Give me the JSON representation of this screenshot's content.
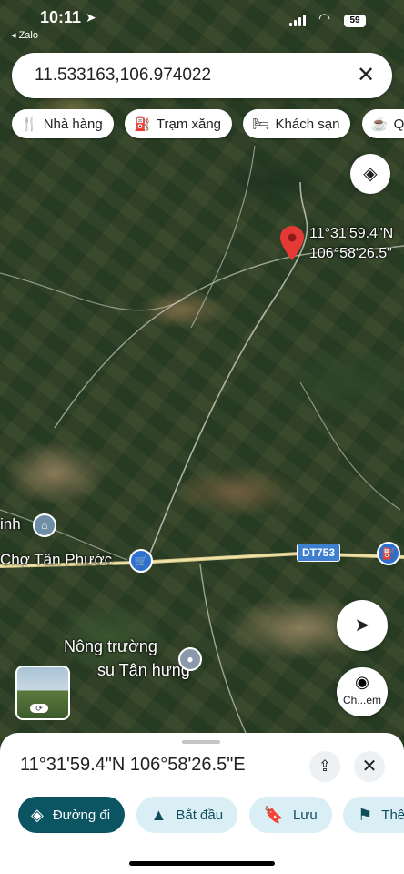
{
  "status_bar": {
    "time": "10:11",
    "back_app": "◂ Zalo",
    "battery": "59"
  },
  "search": {
    "query": "11.533163,106.974022"
  },
  "chips": [
    {
      "icon": "🍴",
      "icon_name": "restaurant-icon",
      "label": "Nhà hàng"
    },
    {
      "icon": "⛽",
      "icon_name": "gas-station-icon",
      "label": "Trạm xăng"
    },
    {
      "icon": "🛏",
      "icon_name": "hotel-icon",
      "label": "Khách sạn"
    },
    {
      "icon": "☕",
      "icon_name": "cafe-icon",
      "label": "Quá"
    }
  ],
  "map": {
    "pin_coords_line1": "11°31'59.4\"N",
    "pin_coords_line2": "106°58'26.5\"",
    "label_place_1": "inh",
    "label_market": "Chợ Tân Phước",
    "label_farm_line1": "Nông trường",
    "label_farm_line2": "su Tân hưng",
    "road_shield": "DT753"
  },
  "camera_button_label": "Ch...em",
  "sheet": {
    "title": "11°31'59.4\"N 106°58'26.5\"E",
    "actions": [
      {
        "icon": "◈",
        "icon_name": "directions-icon",
        "label": "Đường đi",
        "primary": true
      },
      {
        "icon": "▲",
        "icon_name": "navigation-arrow-icon",
        "label": "Bắt đầu"
      },
      {
        "icon": "🔖",
        "icon_name": "bookmark-icon",
        "label": "Lưu"
      },
      {
        "icon": "⚑",
        "icon_name": "flag-icon",
        "label": "Thê"
      }
    ]
  },
  "colors": {
    "primary_action": "#0b5563",
    "secondary_action": "#d9eef5",
    "pin": "#e53935"
  }
}
